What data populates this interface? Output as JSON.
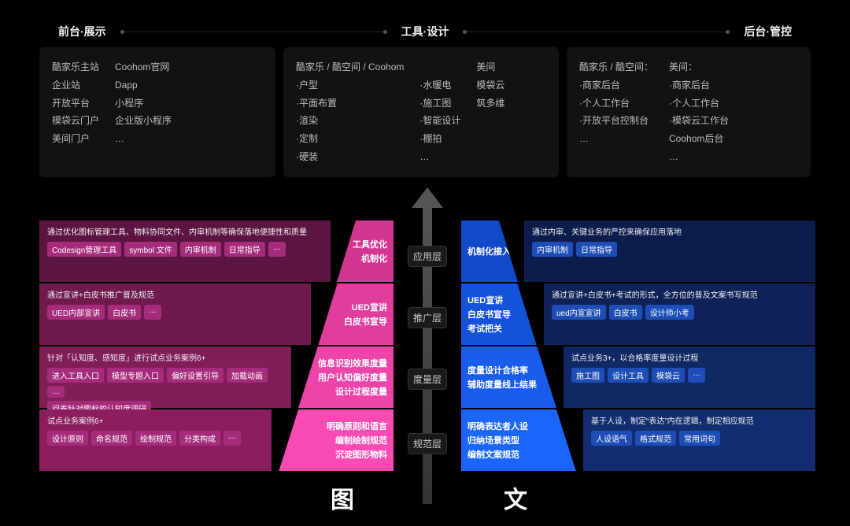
{
  "top": {
    "h1": "前台·展示",
    "h2": "工具·设计",
    "h3": "后台·管控",
    "box1": {
      "colA": [
        "酷家乐主站",
        "企业站",
        "开放平台",
        "模袋云门户",
        "美间门户"
      ],
      "colB": [
        "Coohom官网",
        "Dapp",
        "小程序",
        "企业版小程序",
        "…"
      ]
    },
    "box2": {
      "head": "酷家乐 / 酷空间 / Coohom",
      "colA": [
        "·户型",
        "·平面布置",
        "·渲染",
        "·定制",
        "·硬装"
      ],
      "colB": [
        "·水暖电",
        "·施工图",
        "·智能设计",
        "·棚拍",
        "…"
      ],
      "colC": [
        "美间",
        "模袋云",
        "筑多维"
      ]
    },
    "box3": {
      "headA": "酷家乐 / 酷空间：",
      "colA": [
        "·商家后台",
        "·个人工作台",
        "·开放平台控制台",
        "…"
      ],
      "headB": "美间：",
      "colB": [
        "·商家后台",
        "·个人工作台",
        "·模袋云工作台",
        "Coohom后台",
        "…"
      ]
    }
  },
  "layers": [
    "应用层",
    "推广层",
    "度量层",
    "规范层"
  ],
  "left": {
    "title": "图",
    "rows": [
      {
        "slab": [
          "工具优化",
          "机制化"
        ],
        "desc": "通过优化图标管理工具、物料协同文件、内审机制等确保落地便捷性和质量",
        "tags": [
          "Codesign管理工具",
          "symbol 文件",
          "内审机制",
          "日常指导",
          "…"
        ]
      },
      {
        "slab": [
          "UED宣讲",
          "白皮书宣导"
        ],
        "desc": "通过宣讲+白皮书推广普及规范",
        "tags": [
          "UED内部宣讲",
          "白皮书",
          "…"
        ]
      },
      {
        "slab": [
          "信息识别效果度量",
          "用户认知偏好度量",
          "设计过程度量"
        ],
        "desc": "针对「认知度、感知度」进行试点业务案例6+",
        "tags": [
          "进入工具入口",
          "模型专题入口",
          "偏好设置引导",
          "加载动画",
          "…"
        ],
        "tags2": [
          "问卷针对图标的认知度调研"
        ]
      },
      {
        "slab": [
          "明确原则和语言",
          "编制绘制规范",
          "沉淀图形物料"
        ],
        "desc": "试点业务案例6+",
        "tags": [
          "设计原则",
          "命名规范",
          "绘制规范",
          "分类构成",
          "…"
        ]
      }
    ]
  },
  "right": {
    "title": "文",
    "rows": [
      {
        "slab": [
          "机制化接入"
        ],
        "desc": "通过内审、关键业务的严控来确保应用落地",
        "tags": [
          "内审机制",
          "日常指导"
        ]
      },
      {
        "slab": [
          "UED宣讲",
          "白皮书宣导",
          "考试把关"
        ],
        "desc": "通过宣讲+白皮书+考试的形式，全方位的普及文案书写规范",
        "tags": [
          "ued内宣宣讲",
          "白皮书",
          "设计师小考"
        ]
      },
      {
        "slab": [
          "度量设计合格率",
          "辅助度量线上结果"
        ],
        "desc": "试点业务3+，以合格率度量设计过程",
        "tags": [
          "施工图",
          "设计工具",
          "模袋云",
          "…"
        ]
      },
      {
        "slab": [
          "明确表达者人设",
          "归纳场景类型",
          "编制文案规范"
        ],
        "desc": "基于人设，制定“表达”内在逻辑，制定相应规范",
        "tags": [
          "人设语气",
          "格式规范",
          "常用词句"
        ]
      }
    ]
  }
}
